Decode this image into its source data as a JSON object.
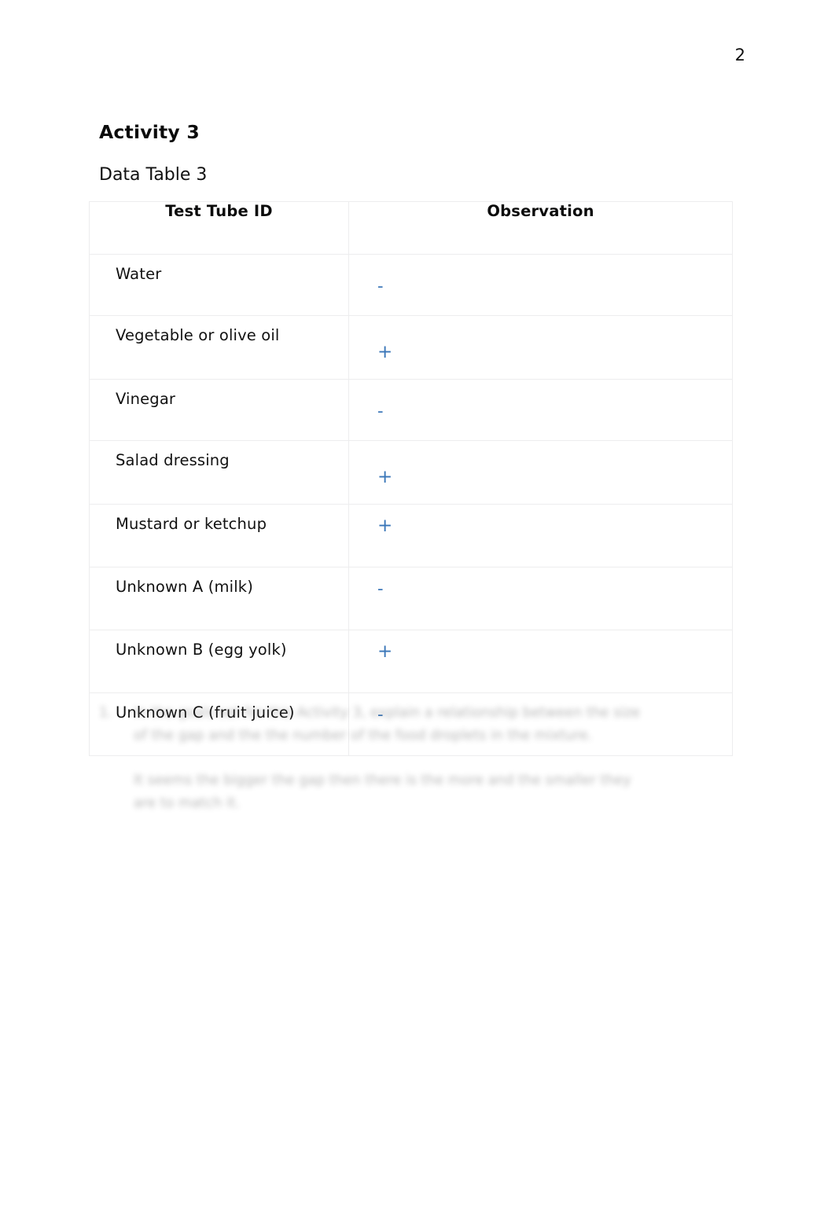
{
  "page": {
    "number": "2"
  },
  "headings": {
    "activity": "Activity 3",
    "data_table": "Data Table 3"
  },
  "table": {
    "columns": [
      {
        "key": "test_tube_id",
        "label": "Test Tube ID"
      },
      {
        "key": "observation",
        "label": "Observation"
      }
    ],
    "rows": [
      {
        "test_tube_id": "Water",
        "observation": "-"
      },
      {
        "test_tube_id": "Vegetable or olive oil",
        "observation": "+"
      },
      {
        "test_tube_id": "Vinegar",
        "observation": "-"
      },
      {
        "test_tube_id": "Salad dressing",
        "observation": "+"
      },
      {
        "test_tube_id": "Mustard or ketchup",
        "observation": "+"
      },
      {
        "test_tube_id": "Unknown A (milk)",
        "observation": "-"
      },
      {
        "test_tube_id": "Unknown B (egg yolk)",
        "observation": "+"
      },
      {
        "test_tube_id": "Unknown C (fruit juice)",
        "observation": "-"
      }
    ]
  },
  "notes": {
    "list_marker": "1.",
    "paragraph_1": "In the goals set for this Activity 3, explain a relationship between the size of the gap and the the number of the food droplets in the mixture.",
    "paragraph_2": "It seems the bigger the gap then there is the more and the smaller they are to match it."
  },
  "colors": {
    "observation_mark": "#3a76b8",
    "table_border": "#ededee",
    "text": "#111111",
    "page_background": "#ffffff"
  }
}
